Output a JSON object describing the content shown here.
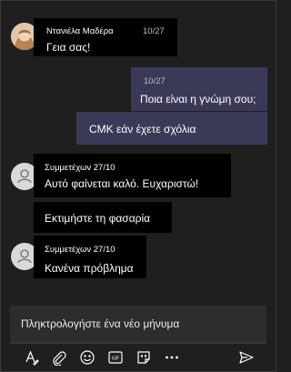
{
  "messages": [
    {
      "sender": "Ντανιέλα Μαδέρα",
      "time": "10/27",
      "text": "Γεια σας!"
    },
    {
      "time": "10/27",
      "text": "Ποια είναι η γνώμη σου;"
    },
    {
      "text": "CMK εάν έχετε σχόλια"
    },
    {
      "sender": "Συμμετέχων 27/10",
      "text": "Αυτό φαίνεται καλό. Ευχαριστώ!"
    },
    {
      "text": "Εκτιμήστε τη φασαρία"
    },
    {
      "sender": "Συμμετέχων 27/10",
      "text": "Κανένα πρόβλημα"
    }
  ],
  "compose": {
    "placeholder": "Πληκτρολογήστε ένα νέο μήνυμα"
  },
  "toolbar": [
    "format-icon",
    "attach-icon",
    "emoji-icon",
    "gif-icon",
    "sticker-icon",
    "more-icon",
    "send-icon"
  ],
  "colors": {
    "background": "#1f1f1f",
    "incoming": "#000000",
    "outgoing": "#3a3a58",
    "compose": "#2d2d2d"
  }
}
